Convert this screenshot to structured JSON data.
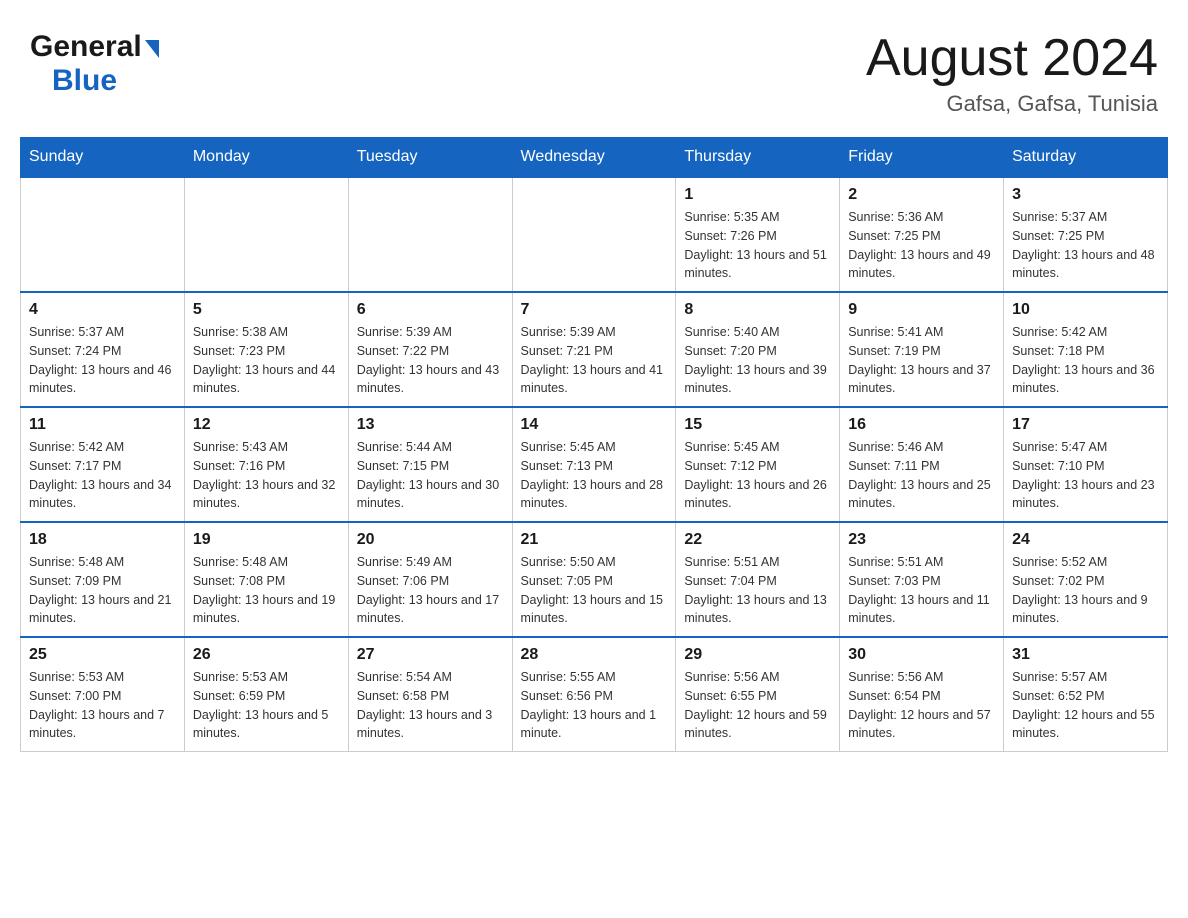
{
  "header": {
    "logo_general": "General",
    "logo_blue": "Blue",
    "month_title": "August 2024",
    "location": "Gafsa, Gafsa, Tunisia"
  },
  "days_of_week": [
    "Sunday",
    "Monday",
    "Tuesday",
    "Wednesday",
    "Thursday",
    "Friday",
    "Saturday"
  ],
  "weeks": [
    {
      "days": [
        {
          "number": "",
          "info": ""
        },
        {
          "number": "",
          "info": ""
        },
        {
          "number": "",
          "info": ""
        },
        {
          "number": "",
          "info": ""
        },
        {
          "number": "1",
          "info": "Sunrise: 5:35 AM\nSunset: 7:26 PM\nDaylight: 13 hours and 51 minutes."
        },
        {
          "number": "2",
          "info": "Sunrise: 5:36 AM\nSunset: 7:25 PM\nDaylight: 13 hours and 49 minutes."
        },
        {
          "number": "3",
          "info": "Sunrise: 5:37 AM\nSunset: 7:25 PM\nDaylight: 13 hours and 48 minutes."
        }
      ]
    },
    {
      "days": [
        {
          "number": "4",
          "info": "Sunrise: 5:37 AM\nSunset: 7:24 PM\nDaylight: 13 hours and 46 minutes."
        },
        {
          "number": "5",
          "info": "Sunrise: 5:38 AM\nSunset: 7:23 PM\nDaylight: 13 hours and 44 minutes."
        },
        {
          "number": "6",
          "info": "Sunrise: 5:39 AM\nSunset: 7:22 PM\nDaylight: 13 hours and 43 minutes."
        },
        {
          "number": "7",
          "info": "Sunrise: 5:39 AM\nSunset: 7:21 PM\nDaylight: 13 hours and 41 minutes."
        },
        {
          "number": "8",
          "info": "Sunrise: 5:40 AM\nSunset: 7:20 PM\nDaylight: 13 hours and 39 minutes."
        },
        {
          "number": "9",
          "info": "Sunrise: 5:41 AM\nSunset: 7:19 PM\nDaylight: 13 hours and 37 minutes."
        },
        {
          "number": "10",
          "info": "Sunrise: 5:42 AM\nSunset: 7:18 PM\nDaylight: 13 hours and 36 minutes."
        }
      ]
    },
    {
      "days": [
        {
          "number": "11",
          "info": "Sunrise: 5:42 AM\nSunset: 7:17 PM\nDaylight: 13 hours and 34 minutes."
        },
        {
          "number": "12",
          "info": "Sunrise: 5:43 AM\nSunset: 7:16 PM\nDaylight: 13 hours and 32 minutes."
        },
        {
          "number": "13",
          "info": "Sunrise: 5:44 AM\nSunset: 7:15 PM\nDaylight: 13 hours and 30 minutes."
        },
        {
          "number": "14",
          "info": "Sunrise: 5:45 AM\nSunset: 7:13 PM\nDaylight: 13 hours and 28 minutes."
        },
        {
          "number": "15",
          "info": "Sunrise: 5:45 AM\nSunset: 7:12 PM\nDaylight: 13 hours and 26 minutes."
        },
        {
          "number": "16",
          "info": "Sunrise: 5:46 AM\nSunset: 7:11 PM\nDaylight: 13 hours and 25 minutes."
        },
        {
          "number": "17",
          "info": "Sunrise: 5:47 AM\nSunset: 7:10 PM\nDaylight: 13 hours and 23 minutes."
        }
      ]
    },
    {
      "days": [
        {
          "number": "18",
          "info": "Sunrise: 5:48 AM\nSunset: 7:09 PM\nDaylight: 13 hours and 21 minutes."
        },
        {
          "number": "19",
          "info": "Sunrise: 5:48 AM\nSunset: 7:08 PM\nDaylight: 13 hours and 19 minutes."
        },
        {
          "number": "20",
          "info": "Sunrise: 5:49 AM\nSunset: 7:06 PM\nDaylight: 13 hours and 17 minutes."
        },
        {
          "number": "21",
          "info": "Sunrise: 5:50 AM\nSunset: 7:05 PM\nDaylight: 13 hours and 15 minutes."
        },
        {
          "number": "22",
          "info": "Sunrise: 5:51 AM\nSunset: 7:04 PM\nDaylight: 13 hours and 13 minutes."
        },
        {
          "number": "23",
          "info": "Sunrise: 5:51 AM\nSunset: 7:03 PM\nDaylight: 13 hours and 11 minutes."
        },
        {
          "number": "24",
          "info": "Sunrise: 5:52 AM\nSunset: 7:02 PM\nDaylight: 13 hours and 9 minutes."
        }
      ]
    },
    {
      "days": [
        {
          "number": "25",
          "info": "Sunrise: 5:53 AM\nSunset: 7:00 PM\nDaylight: 13 hours and 7 minutes."
        },
        {
          "number": "26",
          "info": "Sunrise: 5:53 AM\nSunset: 6:59 PM\nDaylight: 13 hours and 5 minutes."
        },
        {
          "number": "27",
          "info": "Sunrise: 5:54 AM\nSunset: 6:58 PM\nDaylight: 13 hours and 3 minutes."
        },
        {
          "number": "28",
          "info": "Sunrise: 5:55 AM\nSunset: 6:56 PM\nDaylight: 13 hours and 1 minute."
        },
        {
          "number": "29",
          "info": "Sunrise: 5:56 AM\nSunset: 6:55 PM\nDaylight: 12 hours and 59 minutes."
        },
        {
          "number": "30",
          "info": "Sunrise: 5:56 AM\nSunset: 6:54 PM\nDaylight: 12 hours and 57 minutes."
        },
        {
          "number": "31",
          "info": "Sunrise: 5:57 AM\nSunset: 6:52 PM\nDaylight: 12 hours and 55 minutes."
        }
      ]
    }
  ]
}
